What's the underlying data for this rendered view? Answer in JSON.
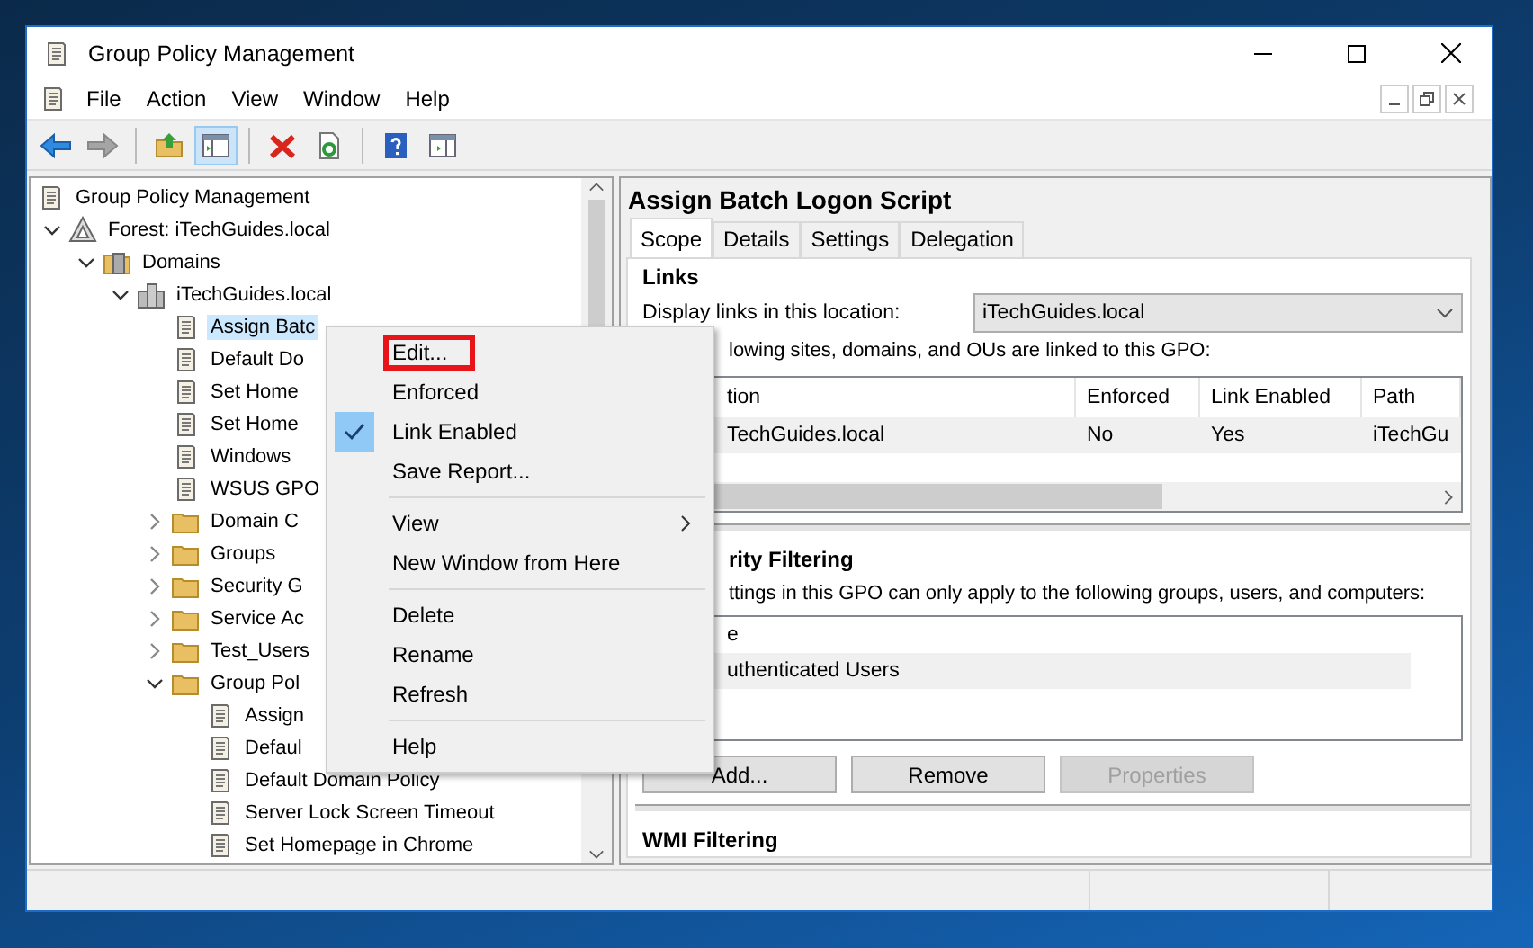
{
  "window": {
    "title": "Group Policy Management"
  },
  "menu_bar": [
    "File",
    "Action",
    "View",
    "Window",
    "Help"
  ],
  "toolbar": [
    {
      "kind": "back",
      "disabled": false,
      "pressed": false
    },
    {
      "kind": "forward",
      "disabled": true,
      "pressed": false
    },
    {
      "kind": "separator"
    },
    {
      "kind": "up",
      "disabled": false,
      "pressed": false
    },
    {
      "kind": "tree",
      "disabled": false,
      "pressed": true
    },
    {
      "kind": "separator"
    },
    {
      "kind": "delete",
      "disabled": false,
      "pressed": false
    },
    {
      "kind": "refresh",
      "disabled": false,
      "pressed": false
    },
    {
      "kind": "separator"
    },
    {
      "kind": "help",
      "disabled": false,
      "pressed": false
    },
    {
      "kind": "pane",
      "disabled": false,
      "pressed": false
    }
  ],
  "tree": [
    {
      "label": "Group Policy Management",
      "kind": "console",
      "selected": false,
      "children": [
        {
          "label": "Forest: iTechGuides.local",
          "kind": "forest",
          "selected": false,
          "expanded": true,
          "children": [
            {
              "label": "Domains",
              "kind": "domains",
              "selected": false,
              "expanded": true,
              "children": [
                {
                  "label": "iTechGuides.local",
                  "kind": "domain",
                  "selected": false,
                  "expanded": true,
                  "children": [
                    {
                      "label": "Assign Batc",
                      "kind": "gpo-link",
                      "selected": true
                    },
                    {
                      "label": "Default Do",
                      "kind": "gpo-link",
                      "selected": false
                    },
                    {
                      "label": "Set Home",
                      "kind": "gpo-link",
                      "selected": false
                    },
                    {
                      "label": "Set Home",
                      "kind": "gpo-link",
                      "selected": false
                    },
                    {
                      "label": "Windows",
                      "kind": "gpo-link",
                      "selected": false
                    },
                    {
                      "label": "WSUS GPO",
                      "kind": "gpo-link",
                      "selected": false
                    },
                    {
                      "label": "Domain C",
                      "kind": "ou",
                      "selected": false,
                      "expanded": false
                    },
                    {
                      "label": "Groups",
                      "kind": "ou",
                      "selected": false,
                      "expanded": false
                    },
                    {
                      "label": "Security G",
                      "kind": "ou",
                      "selected": false,
                      "expanded": false
                    },
                    {
                      "label": "Service Ac",
                      "kind": "ou",
                      "selected": false,
                      "expanded": false
                    },
                    {
                      "label": "Test_Users",
                      "kind": "ou",
                      "selected": false,
                      "expanded": false
                    },
                    {
                      "label": "Group Pol",
                      "kind": "gpo-folder",
                      "selected": false,
                      "expanded": true,
                      "children": [
                        {
                          "label": "Assign",
                          "kind": "gpo",
                          "selected": false
                        },
                        {
                          "label": "Defaul",
                          "kind": "gpo",
                          "selected": false
                        },
                        {
                          "label": "Default Domain Policy",
                          "kind": "gpo",
                          "selected": false
                        },
                        {
                          "label": "Server Lock Screen Timeout",
                          "kind": "gpo",
                          "selected": false
                        },
                        {
                          "label": "Set Homepage in Chrome",
                          "kind": "gpo",
                          "selected": false
                        }
                      ]
                    }
                  ]
                }
              ]
            }
          ]
        }
      ]
    }
  ],
  "context_menu": [
    {
      "kind": "item",
      "label": "Edit...",
      "checked": false,
      "submenu": false,
      "highlighted": true
    },
    {
      "kind": "item",
      "label": "Enforced",
      "checked": false,
      "submenu": false,
      "highlighted": false
    },
    {
      "kind": "item",
      "label": "Link Enabled",
      "checked": true,
      "submenu": false,
      "highlighted": false
    },
    {
      "kind": "item",
      "label": "Save Report...",
      "checked": false,
      "submenu": false,
      "highlighted": false
    },
    {
      "kind": "separator"
    },
    {
      "kind": "item",
      "label": "View",
      "checked": false,
      "submenu": true,
      "highlighted": false
    },
    {
      "kind": "item",
      "label": "New Window from Here",
      "checked": false,
      "submenu": false,
      "highlighted": false
    },
    {
      "kind": "separator"
    },
    {
      "kind": "item",
      "label": "Delete",
      "checked": false,
      "submenu": false,
      "highlighted": false
    },
    {
      "kind": "item",
      "label": "Rename",
      "checked": false,
      "submenu": false,
      "highlighted": false
    },
    {
      "kind": "item",
      "label": "Refresh",
      "checked": false,
      "submenu": false,
      "highlighted": false
    },
    {
      "kind": "separator"
    },
    {
      "kind": "item",
      "label": "Help",
      "checked": false,
      "submenu": false,
      "highlighted": false
    }
  ],
  "details": {
    "title": "Assign Batch Logon Script",
    "tabs": [
      {
        "label": "Scope",
        "selected": true
      },
      {
        "label": "Details",
        "selected": false
      },
      {
        "label": "Settings",
        "selected": false
      },
      {
        "label": "Delegation",
        "selected": false
      }
    ],
    "links": {
      "heading": "Links",
      "location_label": "Display links in this location:",
      "location_value": "iTechGuides.local",
      "note": "lowing sites, domains, and OUs are linked to this GPO:",
      "columns": [
        "tion",
        "Enforced",
        "Link Enabled",
        "Path"
      ],
      "rows": [
        {
          "cells": [
            "TechGuides.local",
            "No",
            "Yes",
            "iTechGu"
          ],
          "selected": true
        }
      ]
    },
    "security": {
      "heading": "rity Filtering",
      "note": "ttings in this GPO can only apply to the following groups, users, and computers:",
      "column": "e",
      "rows": [
        {
          "label": "uthenticated Users",
          "selected": true
        }
      ],
      "buttons": [
        {
          "label": "Add...",
          "disabled": false
        },
        {
          "label": "Remove",
          "disabled": false
        },
        {
          "label": "Properties",
          "disabled": true
        }
      ]
    },
    "wmi": {
      "heading": "WMI Filtering"
    }
  }
}
